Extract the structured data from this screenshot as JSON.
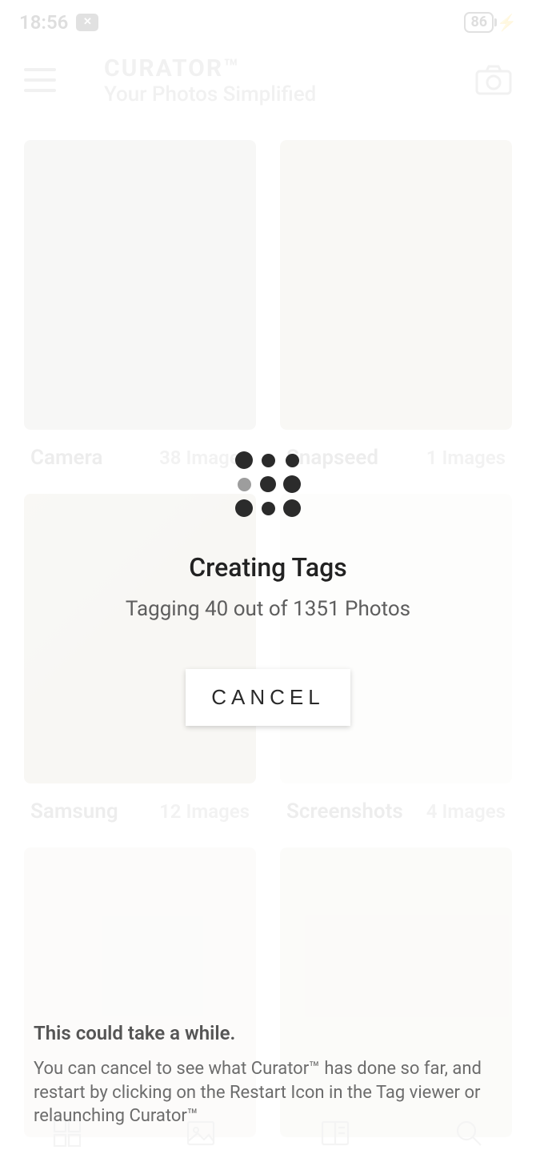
{
  "status_bar": {
    "time": "18:56",
    "battery_percent": "86"
  },
  "header": {
    "title_primary": "CURATOR™",
    "title_secondary": "Your Photos Simplified"
  },
  "albums": [
    {
      "name": "Camera",
      "count": "38 Images"
    },
    {
      "name": "Snapseed",
      "count": "1 Images"
    },
    {
      "name": "Samsung",
      "count": "12 Images"
    },
    {
      "name": "Screenshots",
      "count": "4 Images"
    }
  ],
  "modal": {
    "title": "Creating Tags",
    "progress_text": "Tagging 40 out of 1351 Photos",
    "cancel_label": "CANCEL",
    "current": 40,
    "total": 1351
  },
  "info": {
    "heading": "This could take a while.",
    "body": "You can cancel to see what Curator™ has done so far, and restart by clicking on the Restart Icon in the Tag viewer or relaunching Curator™"
  }
}
